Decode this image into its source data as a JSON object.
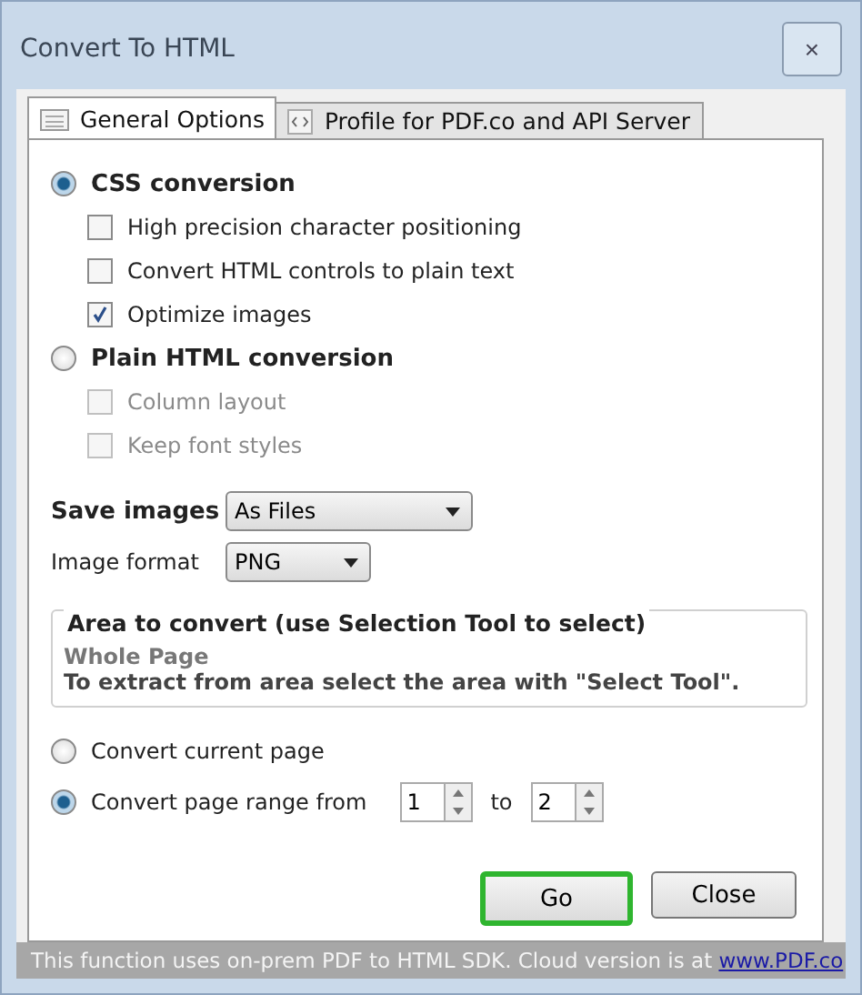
{
  "window": {
    "title": "Convert To HTML",
    "close": "×"
  },
  "tabs": [
    {
      "label": "General Options",
      "selected": true
    },
    {
      "label": "Profile for PDF.co and API Server",
      "selected": false
    }
  ],
  "modes": [
    {
      "label": "CSS conversion",
      "selected": true,
      "options": [
        {
          "label": "High precision character positioning",
          "checked": false,
          "disabled": false
        },
        {
          "label": "Convert HTML controls to plain text",
          "checked": false,
          "disabled": false
        },
        {
          "label": "Optimize images",
          "checked": true,
          "disabled": false
        }
      ]
    },
    {
      "label": "Plain HTML conversion",
      "selected": false,
      "options": [
        {
          "label": "Column layout",
          "checked": false,
          "disabled": true
        },
        {
          "label": "Keep font styles",
          "checked": false,
          "disabled": true
        }
      ]
    }
  ],
  "selects": [
    {
      "label": "Save images",
      "value": "As Files",
      "bold": true
    },
    {
      "label": "Image format",
      "value": "PNG",
      "bold": false
    }
  ],
  "area": {
    "title": "Area to convert (use Selection Tool to select)",
    "value": "Whole Page",
    "hint": "To extract from area select the area with \"Select Tool\"."
  },
  "range": [
    {
      "label": "Convert current page",
      "selected": false
    },
    {
      "label": "Convert page range from",
      "selected": true,
      "from": "1",
      "to_label": "to",
      "to": "2"
    }
  ],
  "buttons": [
    {
      "label": "Go",
      "highlighted": true
    },
    {
      "label": "Close",
      "highlighted": false
    }
  ],
  "footer": {
    "text": "This function uses on-prem PDF to HTML SDK. Cloud version is at ",
    "link": "www.PDF.co"
  }
}
